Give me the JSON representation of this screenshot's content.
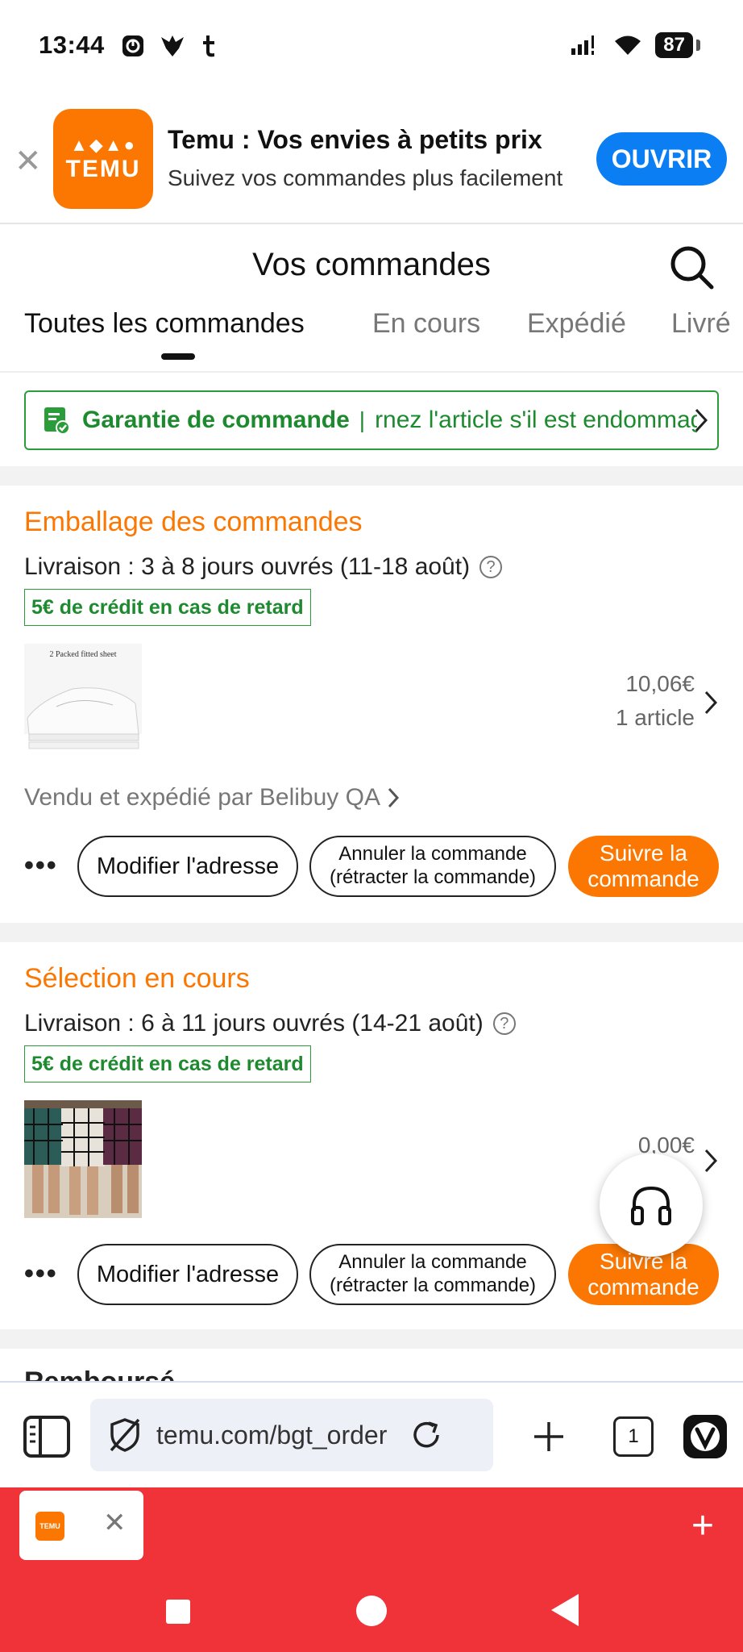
{
  "status_bar": {
    "time": "13:44",
    "battery": "87",
    "left_icons": [
      "app-update-icon",
      "bird-icon",
      "tumblr-icon"
    ],
    "right_icons": [
      "signal-icon",
      "wifi-icon",
      "battery-icon"
    ]
  },
  "app_banner": {
    "app_name": "TEMU",
    "title": "Temu : Vos envies à petits prix",
    "subtitle": "Suivez vos commandes plus facilement",
    "open_label": "OUVRIR"
  },
  "header": {
    "title": "Vos commandes"
  },
  "tabs": [
    {
      "label": "Toutes les commandes",
      "active": true
    },
    {
      "label": "En cours",
      "active": false
    },
    {
      "label": "Expédié",
      "active": false
    },
    {
      "label": "Livré",
      "active": false
    }
  ],
  "guarantee": {
    "title": "Garantie de commande",
    "scrolling_text": "rnez l'article s'il est endommagé"
  },
  "orders": [
    {
      "status": "Emballage des commandes",
      "delivery": "Livraison : 3 à 8 jours ouvrés (11-18 août)",
      "credit": "5€ de crédit en cas de retard",
      "thumb_caption": "2 Packed fitted sheet",
      "price": "10,06€",
      "count": "1 article",
      "seller": "Vendu et expédié par Belibuy QA",
      "more_label": "•••",
      "btn_address": "Modifier l'adresse",
      "btn_cancel": "Annuler la commande (rétracter la commande)",
      "btn_track": "Suivre la commande"
    },
    {
      "status": "Sélection en cours",
      "delivery": "Livraison : 6 à 11 jours ouvrés (14-21 août)",
      "credit": "5€ de crédit en cas de retard",
      "price": "0,00€",
      "more_label": "•••",
      "btn_address": "Modifier l'adresse",
      "btn_cancel": "Annuler la commande (rétracter la commande)",
      "btn_track": "Suivre la commande"
    }
  ],
  "peek_section": "Remboursé",
  "browser": {
    "url": "temu.com/bgt_order",
    "tab_count": "1"
  },
  "tab_strip": {
    "tab_logo": "TEMU"
  },
  "colors": {
    "brand_orange": "#fb7701",
    "open_blue": "#0b7ef4",
    "guarantee_green": "#1e8a2f",
    "tab_strip_red": "#ef3338"
  }
}
